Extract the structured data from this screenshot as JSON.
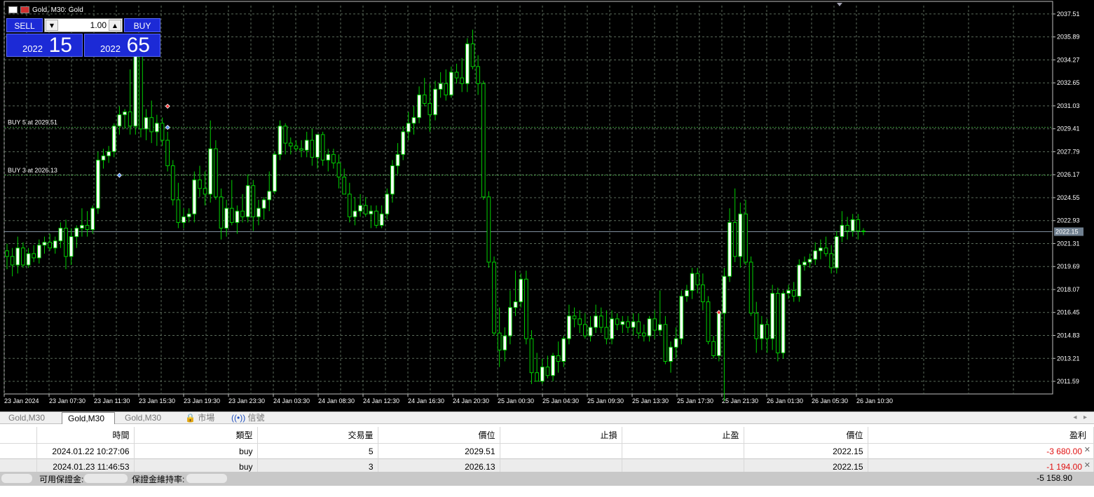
{
  "window": {
    "title": "Gold, M30:  Gold",
    "title_icon_1": "chart-grid-icon",
    "title_icon_2": "chart-window-icon"
  },
  "trade_panel": {
    "sell_label": "SELL",
    "buy_label": "BUY",
    "lot": "1.00",
    "sell_price_small": "2022",
    "sell_price_big": "15",
    "buy_price_small": "2022",
    "buy_price_big": "65",
    "colors": {
      "panel": "#1c2ad6"
    }
  },
  "chart_data": {
    "type": "candlestick",
    "symbol": "Gold",
    "timeframe": "M30",
    "price_axis": [
      "2037.51",
      "2035.89",
      "2034.27",
      "2032.65",
      "2031.03",
      "2029.41",
      "2027.79",
      "2026.17",
      "2024.55",
      "2022.93",
      "2021.31",
      "2019.69",
      "2018.07",
      "2016.45",
      "2014.83",
      "2013.21",
      "2011.59"
    ],
    "ylim": [
      2010.7,
      2038.1
    ],
    "time_axis": [
      "23 Jan 2024",
      "23 Jan 07:30",
      "23 Jan 11:30",
      "23 Jan 15:30",
      "23 Jan 19:30",
      "23 Jan 23:30",
      "24 Jan 03:30",
      "24 Jan 08:30",
      "24 Jan 12:30",
      "24 Jan 16:30",
      "24 Jan 20:30",
      "25 Jan 00:30",
      "25 Jan 04:30",
      "25 Jan 09:30",
      "25 Jan 13:30",
      "25 Jan 17:30",
      "25 Jan 21:30",
      "26 Jan 01:30",
      "26 Jan 05:30",
      "26 Jan 10:30"
    ],
    "current_price": "2022.15",
    "order_lines": [
      {
        "label": "BUY 5 at 2029.51",
        "price": 2029.51
      },
      {
        "label": "BUY 3 at 2026.13",
        "price": 2026.13
      }
    ],
    "grid": true,
    "colors": {
      "background": "#000000",
      "bull": "#ffffff",
      "bear": "#000000",
      "wick": "#00d000",
      "grid": "#5a6a5a",
      "axis_text": "#ffffff"
    },
    "candles": [
      [
        2020.8,
        2021.3,
        2019.5,
        2020.4
      ],
      [
        2020.4,
        2021.0,
        2019.0,
        2019.8
      ],
      [
        2019.8,
        2021.8,
        2019.2,
        2021.0
      ],
      [
        2021.0,
        2021.4,
        2019.6,
        2019.8
      ],
      [
        2019.8,
        2021.0,
        2019.6,
        2020.6
      ],
      [
        2020.6,
        2021.2,
        2020.0,
        2020.3
      ],
      [
        2020.3,
        2021.6,
        2019.9,
        2021.2
      ],
      [
        2021.2,
        2021.8,
        2020.6,
        2021.4
      ],
      [
        2021.4,
        2022.0,
        2020.8,
        2021.0
      ],
      [
        2021.0,
        2021.8,
        2020.6,
        2021.5
      ],
      [
        2021.5,
        2022.8,
        2021.0,
        2022.4
      ],
      [
        2022.4,
        2023.0,
        2019.5,
        2020.4
      ],
      [
        2020.4,
        2022.4,
        2019.8,
        2021.8
      ],
      [
        2021.8,
        2022.6,
        2021.0,
        2022.4
      ],
      [
        2022.4,
        2023.8,
        2021.8,
        2022.6
      ],
      [
        2022.6,
        2023.6,
        2021.8,
        2022.3
      ],
      [
        2022.3,
        2024.0,
        2022.0,
        2023.8
      ],
      [
        2023.8,
        2027.8,
        2023.4,
        2027.2
      ],
      [
        2027.2,
        2028.0,
        2026.6,
        2027.5
      ],
      [
        2027.5,
        2028.2,
        2027.0,
        2027.8
      ],
      [
        2027.8,
        2029.8,
        2027.4,
        2029.6
      ],
      [
        2029.6,
        2031.0,
        2029.0,
        2030.4
      ],
      [
        2030.4,
        2030.8,
        2029.4,
        2030.6
      ],
      [
        2030.6,
        2033.6,
        2029.0,
        2029.6
      ],
      [
        2029.6,
        2035.4,
        2029.0,
        2034.8
      ],
      [
        2034.8,
        2035.2,
        2028.8,
        2029.4
      ],
      [
        2029.4,
        2030.8,
        2028.6,
        2030.2
      ],
      [
        2030.2,
        2031.4,
        2028.4,
        2029.2
      ],
      [
        2029.2,
        2030.4,
        2028.2,
        2029.8
      ],
      [
        2029.8,
        2030.2,
        2028.2,
        2028.6
      ],
      [
        2028.6,
        2029.2,
        2026.4,
        2026.8
      ],
      [
        2026.8,
        2027.2,
        2024.0,
        2024.4
      ],
      [
        2024.4,
        2025.6,
        2022.4,
        2022.8
      ],
      [
        2022.8,
        2023.8,
        2022.4,
        2023.2
      ],
      [
        2023.2,
        2023.8,
        2022.8,
        2023.4
      ],
      [
        2023.4,
        2026.4,
        2022.8,
        2025.8
      ],
      [
        2025.8,
        2026.8,
        2024.6,
        2025.2
      ],
      [
        2025.2,
        2026.4,
        2024.0,
        2024.8
      ],
      [
        2024.8,
        2030.0,
        2024.2,
        2028.0
      ],
      [
        2028.0,
        2028.6,
        2024.4,
        2024.6
      ],
      [
        2024.6,
        2025.2,
        2021.6,
        2022.4
      ],
      [
        2022.4,
        2024.4,
        2021.8,
        2023.8
      ],
      [
        2023.8,
        2025.8,
        2022.6,
        2022.8
      ],
      [
        2022.8,
        2024.0,
        2022.0,
        2023.6
      ],
      [
        2023.6,
        2024.8,
        2022.8,
        2023.2
      ],
      [
        2023.2,
        2026.2,
        2022.8,
        2025.4
      ],
      [
        2025.4,
        2025.8,
        2022.2,
        2023.2
      ],
      [
        2023.2,
        2024.4,
        2022.6,
        2023.8
      ],
      [
        2023.8,
        2024.6,
        2023.0,
        2024.4
      ],
      [
        2024.4,
        2026.4,
        2023.6,
        2025.0
      ],
      [
        2025.0,
        2027.8,
        2024.8,
        2027.6
      ],
      [
        2027.6,
        2030.0,
        2027.2,
        2029.6
      ],
      [
        2029.6,
        2029.8,
        2027.6,
        2028.4
      ],
      [
        2028.4,
        2028.8,
        2027.6,
        2028.2
      ],
      [
        2028.2,
        2028.6,
        2027.8,
        2028.0
      ],
      [
        2028.0,
        2028.6,
        2027.4,
        2027.9
      ],
      [
        2027.9,
        2029.2,
        2027.4,
        2028.6
      ],
      [
        2028.6,
        2029.4,
        2026.8,
        2027.4
      ],
      [
        2027.4,
        2029.0,
        2026.6,
        2029.0
      ],
      [
        2029.0,
        2029.2,
        2026.8,
        2027.2
      ],
      [
        2027.2,
        2028.0,
        2026.4,
        2027.6
      ],
      [
        2027.6,
        2028.0,
        2026.6,
        2027.0
      ],
      [
        2027.0,
        2027.6,
        2025.2,
        2026.0
      ],
      [
        2026.0,
        2026.6,
        2024.8,
        2024.8
      ],
      [
        2024.8,
        2025.6,
        2022.8,
        2023.2
      ],
      [
        2023.2,
        2024.6,
        2022.6,
        2023.6
      ],
      [
        2023.6,
        2024.8,
        2023.2,
        2024.0
      ],
      [
        2024.0,
        2024.6,
        2023.2,
        2023.4
      ],
      [
        2023.4,
        2024.0,
        2022.4,
        2023.6
      ],
      [
        2023.6,
        2024.0,
        2022.4,
        2022.6
      ],
      [
        2022.6,
        2024.0,
        2022.4,
        2023.4
      ],
      [
        2023.4,
        2025.2,
        2023.0,
        2024.8
      ],
      [
        2024.8,
        2027.2,
        2024.2,
        2026.8
      ],
      [
        2026.8,
        2028.4,
        2026.2,
        2027.6
      ],
      [
        2027.6,
        2029.6,
        2027.2,
        2029.2
      ],
      [
        2029.2,
        2030.6,
        2028.6,
        2029.8
      ],
      [
        2029.8,
        2031.0,
        2029.0,
        2030.2
      ],
      [
        2030.2,
        2032.4,
        2029.8,
        2031.8
      ],
      [
        2031.8,
        2033.0,
        2031.0,
        2031.2
      ],
      [
        2031.2,
        2032.6,
        2029.2,
        2030.4
      ],
      [
        2030.4,
        2032.8,
        2030.0,
        2032.2
      ],
      [
        2032.2,
        2033.4,
        2031.6,
        2032.6
      ],
      [
        2032.6,
        2033.6,
        2031.4,
        2031.8
      ],
      [
        2031.8,
        2033.8,
        2031.6,
        2033.4
      ],
      [
        2033.4,
        2034.0,
        2032.6,
        2033.0
      ],
      [
        2033.0,
        2034.4,
        2032.0,
        2032.6
      ],
      [
        2032.6,
        2035.8,
        2032.0,
        2035.4
      ],
      [
        2035.4,
        2036.4,
        2033.6,
        2033.8
      ],
      [
        2033.8,
        2034.6,
        2031.8,
        2032.6
      ],
      [
        2032.6,
        2032.8,
        2024.4,
        2024.6
      ],
      [
        2024.6,
        2025.0,
        2019.6,
        2020.0
      ],
      [
        2020.0,
        2020.4,
        2014.8,
        2015.0
      ],
      [
        2015.0,
        2016.8,
        2012.6,
        2013.8
      ],
      [
        2013.8,
        2015.4,
        2013.0,
        2014.8
      ],
      [
        2014.8,
        2018.0,
        2014.2,
        2016.8
      ],
      [
        2016.8,
        2019.4,
        2016.2,
        2017.2
      ],
      [
        2017.2,
        2019.2,
        2016.8,
        2018.8
      ],
      [
        2018.8,
        2019.4,
        2014.2,
        2014.6
      ],
      [
        2014.6,
        2015.2,
        2011.4,
        2012.2
      ],
      [
        2012.2,
        2013.6,
        2011.6,
        2011.6
      ],
      [
        2011.6,
        2013.2,
        2011.4,
        2012.6
      ],
      [
        2012.6,
        2013.4,
        2011.8,
        2012.0
      ],
      [
        2012.0,
        2013.6,
        2011.6,
        2013.4
      ],
      [
        2013.4,
        2014.4,
        2012.2,
        2013.0
      ],
      [
        2013.0,
        2014.8,
        2012.6,
        2014.6
      ],
      [
        2014.6,
        2017.0,
        2014.2,
        2016.2
      ],
      [
        2016.2,
        2016.8,
        2015.4,
        2016.0
      ],
      [
        2016.0,
        2016.6,
        2015.0,
        2015.6
      ],
      [
        2015.6,
        2016.4,
        2014.6,
        2014.8
      ],
      [
        2014.8,
        2016.2,
        2014.4,
        2015.4
      ],
      [
        2015.4,
        2017.0,
        2015.0,
        2016.2
      ],
      [
        2016.2,
        2016.8,
        2015.0,
        2015.4
      ],
      [
        2015.4,
        2016.6,
        2014.2,
        2014.6
      ],
      [
        2014.6,
        2016.6,
        2014.2,
        2016.0
      ],
      [
        2016.0,
        2016.4,
        2015.2,
        2015.6
      ],
      [
        2015.6,
        2016.2,
        2015.0,
        2015.8
      ],
      [
        2015.8,
        2016.2,
        2015.0,
        2015.4
      ],
      [
        2015.4,
        2016.4,
        2014.8,
        2015.8
      ],
      [
        2015.8,
        2016.4,
        2014.6,
        2015.0
      ],
      [
        2015.0,
        2015.6,
        2014.4,
        2014.8
      ],
      [
        2014.8,
        2016.2,
        2014.4,
        2016.0
      ],
      [
        2016.0,
        2016.6,
        2014.6,
        2015.2
      ],
      [
        2015.2,
        2018.0,
        2014.8,
        2015.6
      ],
      [
        2015.6,
        2016.2,
        2012.8,
        2013.0
      ],
      [
        2013.0,
        2014.4,
        2012.2,
        2014.0
      ],
      [
        2014.0,
        2015.4,
        2013.2,
        2014.6
      ],
      [
        2014.6,
        2018.0,
        2014.2,
        2017.6
      ],
      [
        2017.6,
        2018.4,
        2017.2,
        2018.0
      ],
      [
        2018.0,
        2019.6,
        2017.4,
        2019.2
      ],
      [
        2019.2,
        2019.6,
        2017.8,
        2018.4
      ],
      [
        2018.4,
        2019.2,
        2016.6,
        2017.2
      ],
      [
        2017.2,
        2017.6,
        2014.2,
        2014.4
      ],
      [
        2014.4,
        2014.8,
        2013.2,
        2013.4
      ],
      [
        2013.4,
        2016.6,
        2013.0,
        2016.4
      ],
      [
        2016.4,
        2019.6,
        2010.2,
        2019.0
      ],
      [
        2019.0,
        2023.8,
        2018.6,
        2022.8
      ],
      [
        2022.8,
        2025.2,
        2020.0,
        2020.4
      ],
      [
        2020.4,
        2024.2,
        2019.6,
        2023.4
      ],
      [
        2023.4,
        2024.4,
        2019.8,
        2020.0
      ],
      [
        2020.0,
        2020.4,
        2016.2,
        2016.4
      ],
      [
        2016.4,
        2017.2,
        2013.6,
        2014.6
      ],
      [
        2014.6,
        2016.2,
        2013.8,
        2015.6
      ],
      [
        2015.6,
        2016.0,
        2013.6,
        2014.6
      ],
      [
        2014.6,
        2018.4,
        2013.8,
        2017.8
      ],
      [
        2017.8,
        2018.2,
        2013.0,
        2013.6
      ],
      [
        2013.6,
        2018.0,
        2013.2,
        2017.8
      ],
      [
        2017.8,
        2018.4,
        2017.4,
        2018.0
      ],
      [
        2018.0,
        2018.6,
        2017.2,
        2017.6
      ],
      [
        2017.6,
        2020.2,
        2017.2,
        2019.8
      ],
      [
        2019.8,
        2020.4,
        2019.4,
        2020.0
      ],
      [
        2020.0,
        2020.6,
        2019.6,
        2020.2
      ],
      [
        2020.2,
        2021.4,
        2019.8,
        2020.8
      ],
      [
        2020.8,
        2021.6,
        2020.2,
        2021.0
      ],
      [
        2021.0,
        2021.8,
        2020.4,
        2020.6
      ],
      [
        2020.6,
        2021.2,
        2019.2,
        2019.6
      ],
      [
        2019.6,
        2022.2,
        2019.2,
        2021.8
      ],
      [
        2021.8,
        2023.6,
        2021.4,
        2022.6
      ],
      [
        2022.6,
        2023.2,
        2021.6,
        2022.2
      ],
      [
        2022.2,
        2023.4,
        2021.8,
        2023.0
      ],
      [
        2023.0,
        2023.4,
        2021.6,
        2022.2
      ],
      [
        2022.2,
        2022.4,
        2021.9,
        2022.15
      ]
    ]
  },
  "tabs": [
    {
      "label": "Gold,M30",
      "active": false
    },
    {
      "label": "Gold,M30",
      "active": true
    },
    {
      "label": "Gold,M30",
      "active": false
    },
    {
      "label": "市場",
      "icon": "lock-icon"
    },
    {
      "label": "信號",
      "icon": "signal-icon"
    }
  ],
  "terminal": {
    "headers": [
      "時間",
      "類型",
      "交易量",
      "價位",
      "止損",
      "止盈",
      "價位",
      "盈利"
    ],
    "rows": [
      {
        "time": "2024.01.22 10:27:06",
        "type": "buy",
        "volume": "5",
        "price": "2029.51",
        "sl": "",
        "tp": "",
        "current": "2022.15",
        "profit": "-3 680.00"
      },
      {
        "time": "2024.01.23 11:46:53",
        "type": "buy",
        "volume": "3",
        "price": "2026.13",
        "sl": "",
        "tp": "",
        "current": "2022.15",
        "profit": "-1 194.00"
      }
    ],
    "summary": {
      "free_margin_label": "可用保證金:",
      "margin_level_label": "保證金維持率:",
      "total": "-5 158.90"
    },
    "colors": {
      "loss": "#e01010",
      "summary_bg": "#c8c8c8"
    }
  }
}
